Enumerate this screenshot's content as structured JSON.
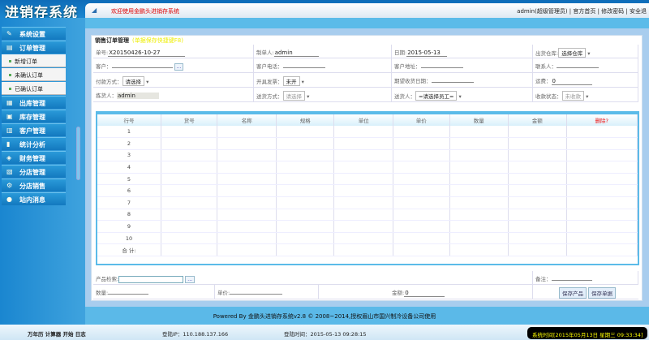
{
  "app": {
    "title": "进销存系统",
    "welcome": "欢迎使用金鹏头进销存系统",
    "user_links": "admin(超级管理员) | 官方首页 | 修改密码 | 安全退"
  },
  "sidebar": {
    "items": [
      {
        "label": "系统设置",
        "icon": "wrench-icon"
      },
      {
        "label": "订单管理",
        "icon": "order-icon"
      },
      {
        "label": "出库管理",
        "icon": "outbound-icon"
      },
      {
        "label": "库存管理",
        "icon": "inventory-icon"
      },
      {
        "label": "客户管理",
        "icon": "customer-icon"
      },
      {
        "label": "统计分析",
        "icon": "chart-icon"
      },
      {
        "label": "财务管理",
        "icon": "finance-icon"
      },
      {
        "label": "分店管理",
        "icon": "branch-icon"
      },
      {
        "label": "分店销售",
        "icon": "gear-icon"
      },
      {
        "label": "站内消息",
        "icon": "info-icon"
      }
    ],
    "subitems": [
      "新增订单",
      "未确认订单",
      "已确认订单"
    ]
  },
  "form": {
    "title": "销售订单管理",
    "hint": "(单据保存快捷键F8)",
    "order_no_label": "单号:",
    "order_no": "X20150426-10-27",
    "maker_label": "制单人:",
    "maker": "admin",
    "date_label": "日期:",
    "date": "2015-05-13",
    "warehouse_label": "出货仓库:",
    "warehouse": "选择仓库",
    "customer_label": "客户：",
    "customer": "",
    "phone_label": "客户电话：",
    "address_label": "客户地址：",
    "contact_label": "联系人：",
    "payment_label": "付款方式：",
    "payment": "请选择",
    "invoice_label": "开具发票：",
    "invoice": "未开",
    "expected_label": "期望收货日期：",
    "freight_label": "运费：",
    "freight": "0",
    "picker_label": "拣货人：",
    "picker": "admin",
    "ship_label": "送货方式：",
    "ship": "请选择",
    "deliverer_label": "送货人：",
    "deliverer": "=请选择员工=",
    "pay_status_label": "收款状态：",
    "pay_status": "未收款",
    "browse": "..."
  },
  "table": {
    "headers": [
      "行号",
      "货号",
      "名称",
      "规格",
      "单位",
      "单价",
      "数量",
      "金额",
      "删除?"
    ],
    "rows": [
      "1",
      "2",
      "3",
      "4",
      "5",
      "6",
      "7",
      "8",
      "9",
      "10"
    ],
    "total_label": "合 计:"
  },
  "bottom": {
    "search_label": "产品检索:",
    "remark_label": "备注：",
    "qty_label": "数量:",
    "price_label": "单价:",
    "amount_label": "金额:",
    "amount": "0",
    "save_product": "保存产品",
    "save_order": "保存单据"
  },
  "footer": "Powered By 金鹏头进销存系统v2.8 © 2008~2014,授权眉山市国兴制冷设备公司使用",
  "status": {
    "tools": "万年历  计算器  开始  日志",
    "ip": "登陆IP：110.188.137.166",
    "login_time": "登陆时间：2015-05-13 09:28:15",
    "clock": "系统时间[2015年05月13日 星期三 09:33:34]"
  }
}
